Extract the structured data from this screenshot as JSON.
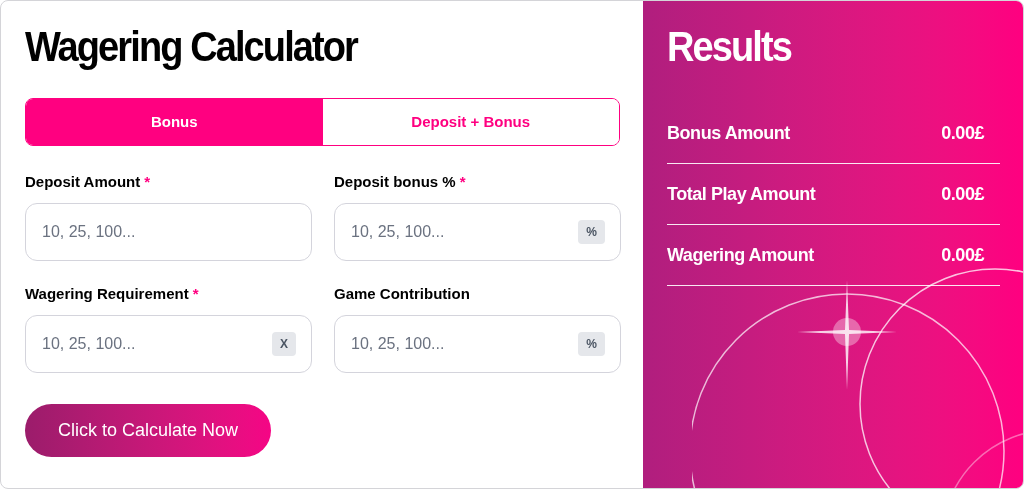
{
  "calculator": {
    "title": "Wagering Calculator",
    "tabs": [
      {
        "label": "Bonus",
        "selected": true
      },
      {
        "label": "Deposit + Bonus",
        "selected": false
      }
    ],
    "fields": [
      {
        "label": "Deposit Amount",
        "required_mark": "*",
        "placeholder": "10, 25, 100..."
      },
      {
        "label": "Deposit bonus %",
        "required_mark": "*",
        "placeholder": "10, 25, 100...",
        "suffix": "%"
      },
      {
        "label": "Wagering Requirement",
        "required_mark": "*",
        "placeholder": "10, 25, 100...",
        "suffix": "X"
      },
      {
        "label": "Game Contribution",
        "placeholder": "10, 25, 100...",
        "suffix": "%"
      }
    ],
    "button": "Click to Calculate Now"
  },
  "results": {
    "title": "Results",
    "rows": [
      {
        "label": "Bonus Amount",
        "value": "0.00£"
      },
      {
        "label": "Total Play Amount",
        "value": "0.00£"
      },
      {
        "label": "Wagering Amount",
        "value": "0.00£"
      }
    ]
  }
}
